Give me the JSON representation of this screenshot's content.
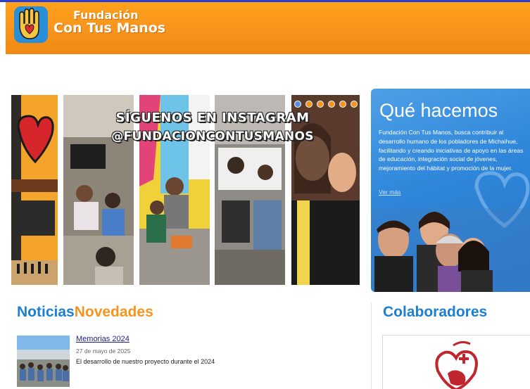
{
  "header": {
    "brand_line1": "Fundación",
    "brand_line2": "Con Tus Manos",
    "bg_color": "#f7941d"
  },
  "slider": {
    "overlay_line1": "SÍGUENOS EN INSTAGRAM",
    "overlay_line2": "@FUNDACIONCONTUSMANOS",
    "dots_count": 6,
    "active_dot": 1
  },
  "que_hacemos": {
    "title": "Qué hacemos",
    "text": "Fundación Con Tus Manos, busca contribuir al desarrollo humano de los pobladores de Michaihue, facilitando y creando iniciativas de apoyo en las áreas de educación, integración social de jóvenes, mejoramiento del hábitat y promoción de la mujer.",
    "link": "Ver más",
    "bg_color": "#2f86da"
  },
  "news": {
    "heading_part1": "Noticias",
    "heading_part2": "Novedades",
    "items": [
      {
        "title": "Memorias 2024",
        "date": "27 de mayo de 2025",
        "description": "El desarrollo de nuestro proyecto durante el 2024"
      }
    ]
  },
  "collaborators": {
    "heading": "Colaboradores"
  },
  "colors": {
    "accent_blue": "#1d7fd1",
    "accent_orange": "#f7941d"
  }
}
